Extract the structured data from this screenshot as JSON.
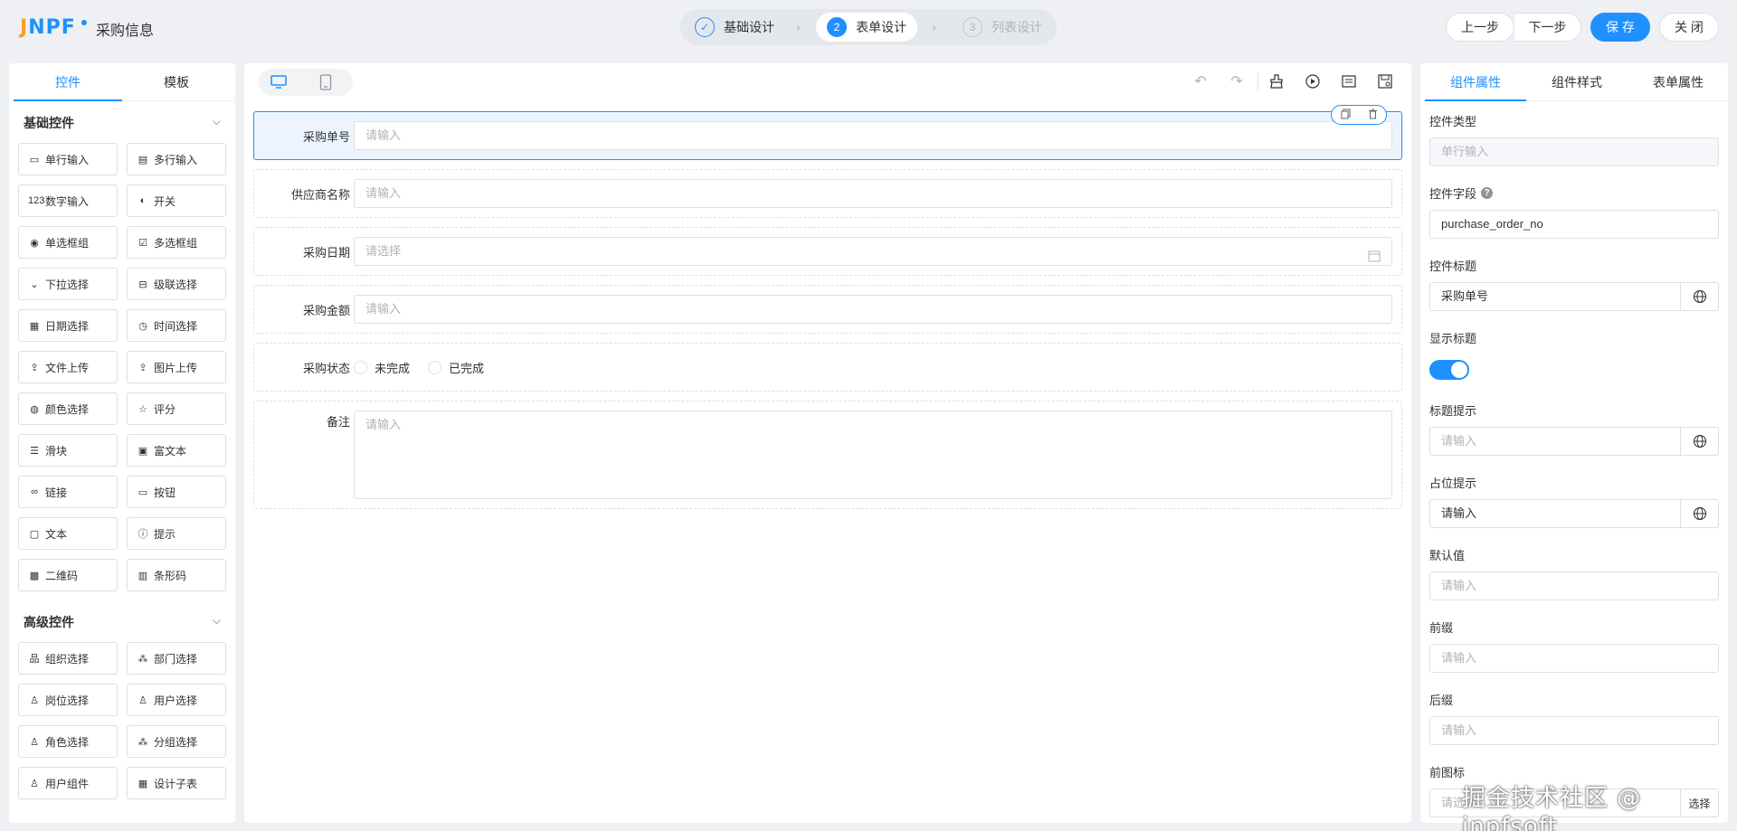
{
  "header": {
    "logo_text": "JNPF",
    "app_title": "采购信息",
    "steps": [
      {
        "num": "✓",
        "label": "基础设计"
      },
      {
        "num": "2",
        "label": "表单设计"
      },
      {
        "num": "3",
        "label": "列表设计"
      }
    ],
    "buttons": {
      "prev": "上一步",
      "next": "下一步",
      "save": "保 存",
      "close": "关 闭"
    }
  },
  "left_panel": {
    "tabs": [
      "控件",
      "模板"
    ],
    "basic": {
      "title": "基础控件",
      "items": [
        {
          "icon": "▭",
          "label": "单行输入"
        },
        {
          "icon": "▤",
          "label": "多行输入"
        },
        {
          "icon": "123",
          "label": "数字输入"
        },
        {
          "icon": "◐",
          "label": "开关"
        },
        {
          "icon": "◉",
          "label": "单选框组"
        },
        {
          "icon": "☑",
          "label": "多选框组"
        },
        {
          "icon": "⌄",
          "label": "下拉选择"
        },
        {
          "icon": "⊟",
          "label": "级联选择"
        },
        {
          "icon": "▦",
          "label": "日期选择"
        },
        {
          "icon": "◷",
          "label": "时间选择"
        },
        {
          "icon": "⇪",
          "label": "文件上传"
        },
        {
          "icon": "⇪",
          "label": "图片上传"
        },
        {
          "icon": "◍",
          "label": "颜色选择"
        },
        {
          "icon": "☆",
          "label": "评分"
        },
        {
          "icon": "☰",
          "label": "滑块"
        },
        {
          "icon": "▣",
          "label": "富文本"
        },
        {
          "icon": "∞",
          "label": "链接"
        },
        {
          "icon": "▭",
          "label": "按钮"
        },
        {
          "icon": "▢",
          "label": "文本"
        },
        {
          "icon": "ⓘ",
          "label": "提示"
        },
        {
          "icon": "▩",
          "label": "二维码"
        },
        {
          "icon": "▥",
          "label": "条形码"
        }
      ]
    },
    "advanced": {
      "title": "高级控件",
      "items": [
        {
          "icon": "品",
          "label": "组织选择"
        },
        {
          "icon": "⁂",
          "label": "部门选择"
        },
        {
          "icon": "♙",
          "label": "岗位选择"
        },
        {
          "icon": "♙",
          "label": "用户选择"
        },
        {
          "icon": "♙",
          "label": "角色选择"
        },
        {
          "icon": "⁂",
          "label": "分组选择"
        },
        {
          "icon": "♙",
          "label": "用户组件"
        },
        {
          "icon": "▦",
          "label": "设计子表"
        }
      ]
    }
  },
  "canvas": {
    "rows": [
      {
        "label": "采购单号",
        "placeholder": "请输入",
        "type": "input"
      },
      {
        "label": "供应商名称",
        "placeholder": "请输入",
        "type": "input"
      },
      {
        "label": "采购日期",
        "placeholder": "请选择",
        "type": "date"
      },
      {
        "label": "采购金额",
        "placeholder": "请输入",
        "type": "input"
      },
      {
        "label": "采购状态",
        "type": "radio",
        "options": [
          "未完成",
          "已完成"
        ]
      },
      {
        "label": "备注",
        "placeholder": "请输入",
        "type": "textarea"
      }
    ]
  },
  "right_panel": {
    "tabs": [
      "组件属性",
      "组件样式",
      "表单属性"
    ],
    "props": {
      "type_label": "控件类型",
      "type_value": "单行输入",
      "field_label": "控件字段",
      "field_help": "?",
      "field_value": "purchase_order_no",
      "title_label": "控件标题",
      "title_value": "采购单号",
      "show_title_label": "显示标题",
      "title_tip_label": "标题提示",
      "title_tip_placeholder": "请输入",
      "placeholder_label": "占位提示",
      "placeholder_value": "请输入",
      "default_label": "默认值",
      "default_placeholder": "请输入",
      "prefix_label": "前缀",
      "prefix_placeholder": "请输入",
      "suffix_label": "后缀",
      "suffix_placeholder": "请输入",
      "prefix_icon_label": "前图标",
      "prefix_icon_placeholder": "请选",
      "prefix_icon_button": "选择"
    }
  },
  "watermark": "掘金技术社区 @ jnpfsoft",
  "colors": {
    "accent": "#1e90ff",
    "logo_orange": "#f5a623"
  }
}
